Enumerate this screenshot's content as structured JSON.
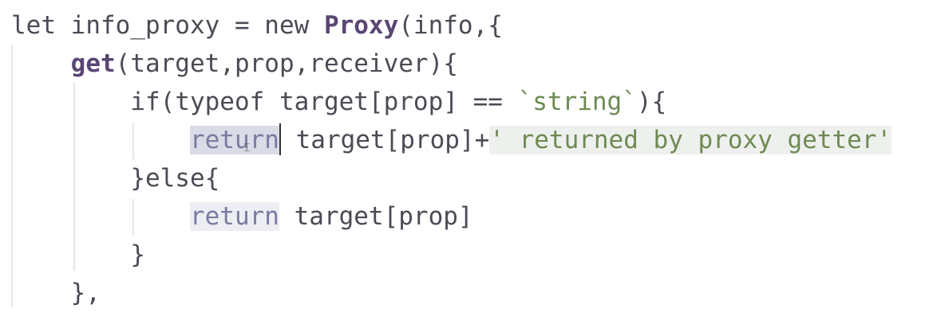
{
  "code": {
    "line1": {
      "pre": "let info_proxy = new ",
      "class": "Proxy",
      "post": "(info,{"
    },
    "line2": {
      "indent": "    ",
      "fn": "get",
      "post": "(target,prop,receiver){"
    },
    "line3": {
      "indent": "        ",
      "pre": "if(typeof target[prop] == ",
      "str": "`string`",
      "post": "){"
    },
    "line4": {
      "indent": "            ",
      "kw": "return",
      "mid": " target[prop]+",
      "str": "' returned by proxy getter'"
    },
    "line5": {
      "indent": "        ",
      "text": "}else{"
    },
    "line6": {
      "indent": "            ",
      "kw": "return",
      "mid": " target[prop]"
    },
    "line7": {
      "indent": "        ",
      "text": "}"
    },
    "line8": {
      "indent": "    ",
      "text": "},"
    }
  },
  "colors": {
    "keyword_bold": "#5a4674",
    "string": "#6e8a52",
    "return_highlight": "#d9dbe6"
  }
}
